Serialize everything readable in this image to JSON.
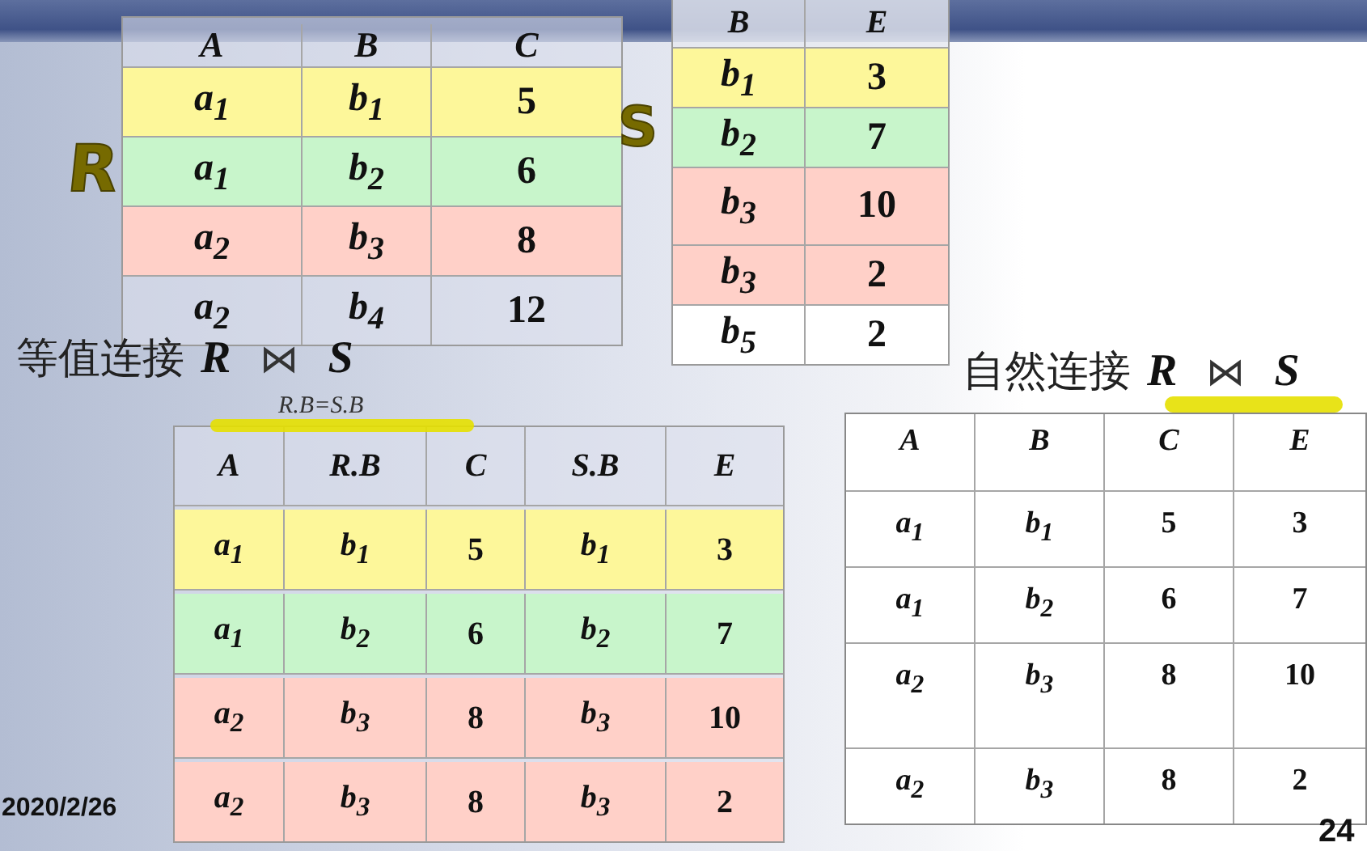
{
  "relation_r": {
    "columns": [
      {
        "label": "A",
        "kind": "symbol"
      },
      {
        "label": "B",
        "kind": "symbol"
      },
      {
        "label": "C",
        "kind": "number"
      }
    ],
    "rows": [
      {
        "cells": [
          "a$_{1}$",
          "b$_{1}$",
          "5"
        ],
        "color": "#fdf79a"
      },
      {
        "cells": [
          "a$_{1}$",
          "b$_{2}$",
          "6"
        ],
        "color": "#c8f5cb"
      },
      {
        "cells": [
          "a$_{2}$",
          "b$_{3}$",
          "8"
        ],
        "color": "#ffd0c8"
      },
      {
        "cells": [
          "a$_{2}$",
          "b$_{4}$",
          "12"
        ]
      }
    ]
  },
  "relation_s": {
    "columns": [
      {
        "label": "B",
        "kind": "symbol"
      },
      {
        "label": "E",
        "kind": "number"
      }
    ],
    "rows": [
      {
        "cells": [
          "b$_{1}$",
          "3"
        ],
        "color": "#fdf79a"
      },
      {
        "cells": [
          "b$_{2}$",
          "7"
        ],
        "color": "#c8f5cb"
      },
      {
        "cells": [
          "b$_{3}$",
          "10"
        ],
        "color": "#ffd0c8"
      },
      {
        "cells": [
          "b$_{3}$",
          "2"
        ],
        "color": "#ffd0c8"
      },
      {
        "cells": [
          "b$_{5}$",
          "2"
        ],
        "color": "#ffffff"
      }
    ]
  },
  "ink_annotations": [
    {
      "text": "R"
    },
    {
      "text": "S"
    }
  ],
  "equijoin": {
    "label": "等值连接",
    "left": "R",
    "operator": "⋈",
    "right": "S",
    "condition": "R.B=S.B",
    "columns": [
      {
        "label": "A",
        "kind": "symbol"
      },
      {
        "label": "R.B",
        "kind": "symbol"
      },
      {
        "label": "C",
        "kind": "number"
      },
      {
        "label": "S.B",
        "kind": "symbol"
      },
      {
        "label": "E",
        "kind": "number"
      }
    ],
    "rows": [
      {
        "cells": [
          "a$_{1}$",
          "b$_{1}$",
          "5",
          "b$_{1}$",
          "3"
        ],
        "color": "#fdf79a"
      },
      {
        "cells": [
          "a$_{1}$",
          "b$_{2}$",
          "6",
          "b$_{2}$",
          "7"
        ],
        "color": "#c8f5cb"
      },
      {
        "cells": [
          "a$_{2}$",
          "b$_{3}$",
          "8",
          "b$_{3}$",
          "10"
        ],
        "color": "#ffd0c8"
      },
      {
        "cells": [
          "a$_{2}$",
          "b$_{3}$",
          "8",
          "b$_{3}$",
          "2"
        ],
        "color": "#ffd0c8"
      }
    ]
  },
  "natural_join": {
    "label": "自然连接",
    "left": "R",
    "operator": "⋈",
    "right": "S",
    "columns": [
      {
        "label": "A",
        "kind": "symbol"
      },
      {
        "label": "B",
        "kind": "symbol"
      },
      {
        "label": "C",
        "kind": "number"
      },
      {
        "label": "E",
        "kind": "number"
      }
    ],
    "rows": [
      {
        "cells": [
          "a$_{1}$",
          "b$_{1}$",
          "5",
          "3"
        ]
      },
      {
        "cells": [
          "a$_{1}$",
          "b$_{2}$",
          "6",
          "7"
        ]
      },
      {
        "cells": [
          "a$_{2}$",
          "b$_{3}$",
          "8",
          "10"
        ]
      },
      {
        "cells": [
          "a$_{2}$",
          "b$_{3}$",
          "8",
          "2"
        ]
      }
    ]
  },
  "date": "2020/2/26",
  "page_number": "24"
}
